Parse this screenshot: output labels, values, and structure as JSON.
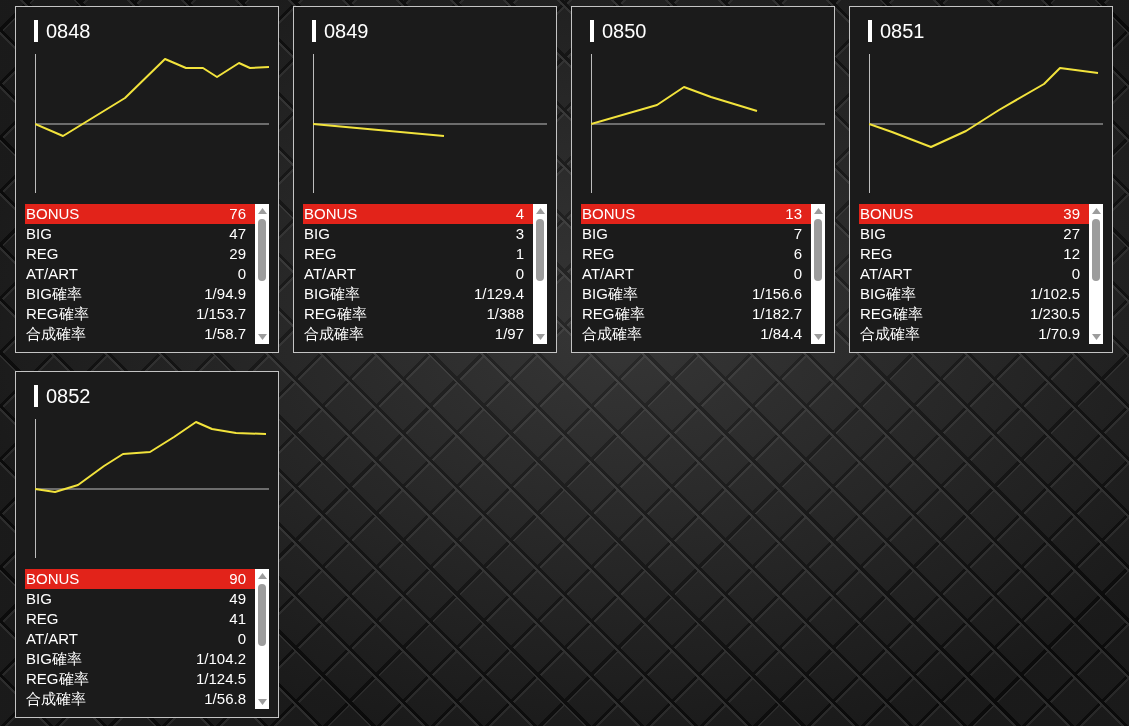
{
  "cards": [
    {
      "title": "0848",
      "rows": [
        {
          "label": "BONUS",
          "value": "76",
          "selected": true
        },
        {
          "label": "BIG",
          "value": "47",
          "selected": false
        },
        {
          "label": "REG",
          "value": "29",
          "selected": false
        },
        {
          "label": "AT/ART",
          "value": "0",
          "selected": false
        },
        {
          "label": "BIG確率",
          "value": "1/94.9",
          "selected": false
        },
        {
          "label": "REG確率",
          "value": "1/153.7",
          "selected": false
        },
        {
          "label": "合成確率",
          "value": "1/58.7",
          "selected": false
        }
      ]
    },
    {
      "title": "0849",
      "rows": [
        {
          "label": "BONUS",
          "value": "4",
          "selected": true
        },
        {
          "label": "BIG",
          "value": "3",
          "selected": false
        },
        {
          "label": "REG",
          "value": "1",
          "selected": false
        },
        {
          "label": "AT/ART",
          "value": "0",
          "selected": false
        },
        {
          "label": "BIG確率",
          "value": "1/129.4",
          "selected": false
        },
        {
          "label": "REG確率",
          "value": "1/388",
          "selected": false
        },
        {
          "label": "合成確率",
          "value": "1/97",
          "selected": false
        }
      ]
    },
    {
      "title": "0850",
      "rows": [
        {
          "label": "BONUS",
          "value": "13",
          "selected": true
        },
        {
          "label": "BIG",
          "value": "7",
          "selected": false
        },
        {
          "label": "REG",
          "value": "6",
          "selected": false
        },
        {
          "label": "AT/ART",
          "value": "0",
          "selected": false
        },
        {
          "label": "BIG確率",
          "value": "1/156.6",
          "selected": false
        },
        {
          "label": "REG確率",
          "value": "1/182.7",
          "selected": false
        },
        {
          "label": "合成確率",
          "value": "1/84.4",
          "selected": false
        }
      ]
    },
    {
      "title": "0851",
      "rows": [
        {
          "label": "BONUS",
          "value": "39",
          "selected": true
        },
        {
          "label": "BIG",
          "value": "27",
          "selected": false
        },
        {
          "label": "REG",
          "value": "12",
          "selected": false
        },
        {
          "label": "AT/ART",
          "value": "0",
          "selected": false
        },
        {
          "label": "BIG確率",
          "value": "1/102.5",
          "selected": false
        },
        {
          "label": "REG確率",
          "value": "1/230.5",
          "selected": false
        },
        {
          "label": "合成確率",
          "value": "1/70.9",
          "selected": false
        }
      ]
    },
    {
      "title": "0852",
      "rows": [
        {
          "label": "BONUS",
          "value": "90",
          "selected": true
        },
        {
          "label": "BIG",
          "value": "49",
          "selected": false
        },
        {
          "label": "REG",
          "value": "41",
          "selected": false
        },
        {
          "label": "AT/ART",
          "value": "0",
          "selected": false
        },
        {
          "label": "BIG確率",
          "value": "1/104.2",
          "selected": false
        },
        {
          "label": "REG確率",
          "value": "1/124.5",
          "selected": false
        },
        {
          "label": "合成確率",
          "value": "1/56.8",
          "selected": false
        }
      ]
    }
  ]
}
